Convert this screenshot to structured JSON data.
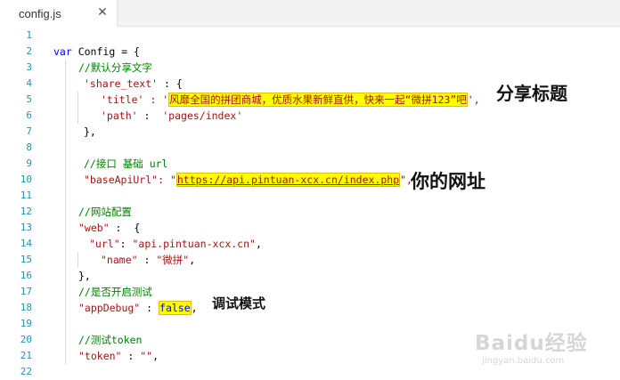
{
  "tab": {
    "filename": "config.js",
    "close_glyph": "✕"
  },
  "lines": [
    "1",
    "2",
    "3",
    "4",
    "5",
    "6",
    "7",
    "8",
    "9",
    "10",
    "11",
    "12",
    "13",
    "14",
    "15",
    "16",
    "17",
    "18",
    "19",
    "20",
    "21",
    "22"
  ],
  "code": {
    "l2_kw": "var",
    "l2_rest": " Config = {",
    "l3": "//默认分享文字",
    "l4_key": "'share_text'",
    "l4_rest": " : {",
    "l5_key": "'title'",
    "l5_colon": " : '",
    "l5_val": "风靡全国的拼团商城，优质水果新鲜直供，快来一起“微拼123”吧",
    "l5_end": "',",
    "l6_key": "'path'",
    "l6_colon": " :  ",
    "l6_val": "'pages/index'",
    "l7": "},",
    "l9": "//接口 基础 url",
    "l10_key": "\"baseApiUrl\"",
    "l10_colon": ": \"",
    "l10_val": "https://api.pintuan-xcx.cn/index.php",
    "l10_end": "\",",
    "l12": "//网站配置",
    "l13_key": "\"web\"",
    "l13_rest": " :  {",
    "l14_key": "\"url\"",
    "l14_colon": ": ",
    "l14_val": "\"api.pintuan-xcx.cn\"",
    "l14_end": ",",
    "l15_key": "\"name\"",
    "l15_colon": " : ",
    "l15_val": "\"微拼\"",
    "l15_end": ",",
    "l16": "},",
    "l17": "//是否开启测试",
    "l18_key": "\"appDebug\"",
    "l18_colon": " : ",
    "l18_val": "false",
    "l18_end": ",",
    "l20": "//测试token",
    "l21_key": "\"token\"",
    "l21_colon": " : ",
    "l21_val": "\"\"",
    "l21_end": ","
  },
  "annotations": {
    "share_title": "分享标题",
    "your_url": "你的网址",
    "debug_mode": "调试模式"
  },
  "watermark": {
    "main": "Baidu经验",
    "sub": "jingyan.baidu.com"
  }
}
